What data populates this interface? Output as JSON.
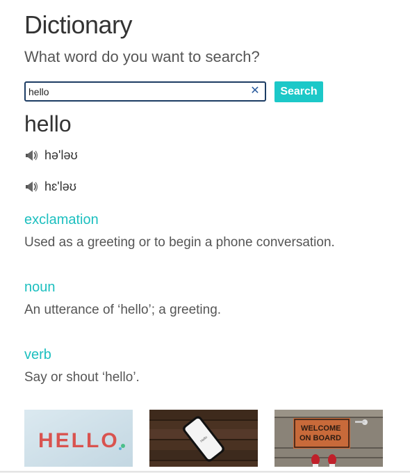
{
  "header": {
    "title": "Dictionary",
    "subtitle": "What word do you want to search?"
  },
  "search": {
    "value": "hello",
    "placeholder": "",
    "button_label": "Search",
    "clear_icon": "close-icon"
  },
  "result": {
    "word": "hello",
    "phonetics": [
      {
        "text": "hə'ləʊ",
        "icon": "speaker-icon"
      },
      {
        "text": "hɛ'ləʊ",
        "icon": "speaker-icon"
      }
    ],
    "meanings": [
      {
        "part_of_speech": "exclamation",
        "definition": "Used as a greeting or to begin a phone conversation."
      },
      {
        "part_of_speech": "noun",
        "definition": "An utterance of ‘hello’; a greeting."
      },
      {
        "part_of_speech": "verb",
        "definition": "Say or shout ‘hello’."
      }
    ]
  },
  "images": [
    {
      "name": "hello-letters-image",
      "text": "HELLO"
    },
    {
      "name": "phone-on-wood-image",
      "text": "Hello"
    },
    {
      "name": "welcome-mat-image",
      "text": "WELCOME ON BOARD"
    }
  ],
  "colors": {
    "accent": "#1cc8c8",
    "search_border": "#1c3c63",
    "pos_text": "#1cbfbf"
  }
}
